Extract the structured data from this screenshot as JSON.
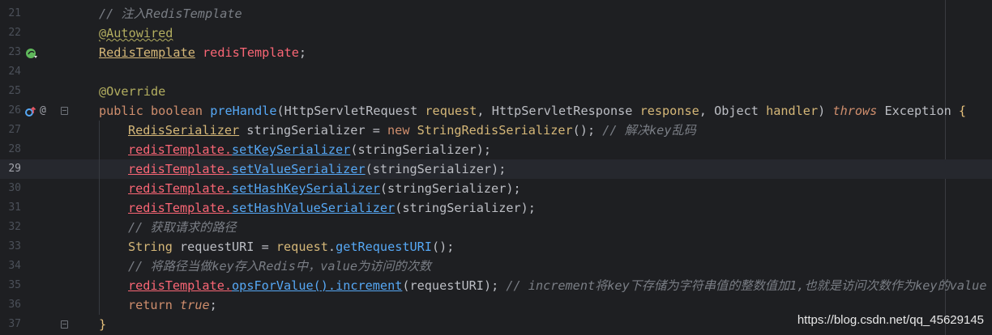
{
  "lines": [
    {
      "n": "21",
      "t": "// 注入RedisTemplate"
    },
    {
      "n": "22",
      "t": "@Autowired"
    },
    {
      "n": "23",
      "t": "RedisTemplate redisTemplate;"
    },
    {
      "n": "24",
      "t": ""
    },
    {
      "n": "25",
      "t": "@Override"
    },
    {
      "n": "26",
      "t": "public boolean preHandle(HttpServletRequest request, HttpServletResponse response, Object handler) throws Exception {"
    },
    {
      "n": "27",
      "t": "RedisSerializer stringSerializer = new StringRedisSerializer(); // 解决key乱码"
    },
    {
      "n": "28",
      "t": "redisTemplate.setKeySerializer(stringSerializer);"
    },
    {
      "n": "29",
      "t": "redisTemplate.setValueSerializer(stringSerializer);"
    },
    {
      "n": "30",
      "t": "redisTemplate.setHashKeySerializer(stringSerializer);"
    },
    {
      "n": "31",
      "t": "redisTemplate.setHashValueSerializer(stringSerializer);"
    },
    {
      "n": "32",
      "t": "// 获取请求的路径"
    },
    {
      "n": "33",
      "t": "String requestURI = request.getRequestURI();"
    },
    {
      "n": "34",
      "t": "// 将路径当做key存入Redis中，value为访问的次数"
    },
    {
      "n": "35",
      "t": "redisTemplate.opsForValue().increment(requestURI); // increment将key下存储为字符串值的整数值加1,也就是访问次数作为key的value"
    },
    {
      "n": "36",
      "t": "return true;"
    },
    {
      "n": "37",
      "t": "}"
    }
  ],
  "tokens": {
    "l21": {
      "c": "// 注入RedisTemplate"
    },
    "l22": {
      "a": "@Autowired"
    },
    "l23": {
      "cls": "RedisTemplate",
      "sp": " ",
      "fld": "redisTemplate",
      "end": ";"
    },
    "l25": {
      "a": "@Override"
    },
    "l26": {
      "kw1": "public",
      "kw2": "boolean",
      "fn": "preHandle",
      "p1": "(",
      "t1": "HttpServletRequest",
      "v1": "request",
      "c1": ", ",
      "t2": "HttpServletResponse",
      "v2": "response",
      "c2": ", ",
      "t3": "Object",
      "v3": "handler",
      "p2": ")",
      "kw3": "throws",
      "t4": "Exception",
      "br": "{"
    },
    "l27": {
      "t": "RedisSerializer",
      "v": " stringSerializer = ",
      "kw": "new",
      "t2": "StringRedisSerializer",
      "end": "();",
      "cm": " // 解决key乱码"
    },
    "l28": {
      "o": "redisTemplate",
      "d": ".",
      "m": "setKeySerializer",
      "a": "(stringSerializer);"
    },
    "l29": {
      "o": "redisTemplate",
      "d": ".",
      "m": "setValueSerializer",
      "a": "(stringSerializer);"
    },
    "l30": {
      "o": "redisTemplate",
      "d": ".",
      "m": "setHashKeySerializer",
      "a": "(stringSerializer);"
    },
    "l31": {
      "o": "redisTemplate",
      "d": ".",
      "m": "setHashValueSerializer",
      "a": "(stringSerializer);"
    },
    "l32": {
      "c": "// 获取请求的路径"
    },
    "l33": {
      "t": "String",
      "v": " requestURI = ",
      "o": "request",
      "d": ".",
      "m": "getRequestURI",
      "e": "();"
    },
    "l34": {
      "c": "// 将路径当做key存入Redis中，value为访问的次数"
    },
    "l35": {
      "o": "redisTemplate",
      "d": ".",
      "m": "opsForValue",
      "m2": "().",
      "m3": "increment",
      "a": "(requestURI);",
      "cm": " // increment将key下存储为字符串值的整数值加1,也就是访问次数作为key的value"
    },
    "l36": {
      "kw": "return",
      "sp": " ",
      "kw2": "true",
      "end": ";"
    },
    "l37": {
      "br": "}"
    }
  },
  "gutter_icons": {
    "bean": "spring-bean-icon",
    "override": "override-icon",
    "at": "@"
  },
  "watermark": "https://blog.csdn.net/qq_45629145",
  "colors": {
    "bg": "#1e1f22",
    "keyword": "#cf8e6d",
    "comment": "#7a7e85",
    "method": "#56a8f5",
    "field": "#c77dbb",
    "annotation": "#b3ae60"
  }
}
